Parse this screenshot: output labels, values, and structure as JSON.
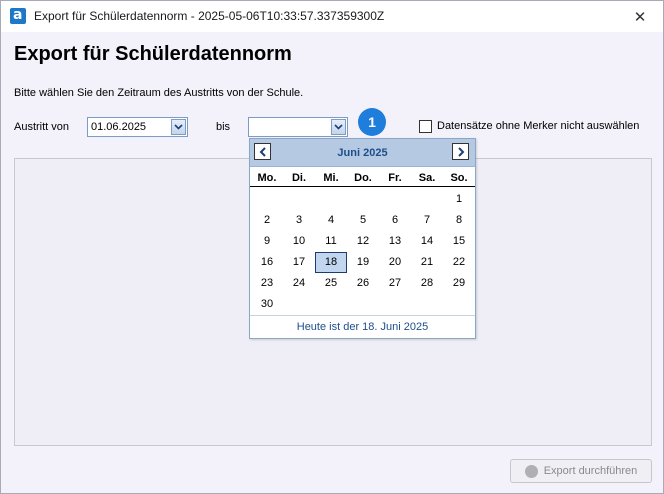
{
  "window": {
    "title": "Export für Schülerdatennorm - 2025-05-06T10:33:57.337359300Z",
    "close_glyph": "✕"
  },
  "header": {
    "title": "Export für Schülerdatennorm",
    "instruction": "Bitte wählen Sie den Zeitraum des Austritts von der Schule."
  },
  "filter": {
    "from_label": "Austritt von",
    "from_value": "01.06.2025",
    "to_label": "bis",
    "to_value": "",
    "marker": "1",
    "checkbox_label": "Datensätze ohne Merker nicht auswählen",
    "checkbox_checked": false
  },
  "calendar": {
    "month_label": "Juni 2025",
    "prev_glyph": "<",
    "next_glyph": ">",
    "weekdays": [
      "Mo.",
      "Di.",
      "Mi.",
      "Do.",
      "Fr.",
      "Sa.",
      "So."
    ],
    "weeks": [
      [
        "",
        "",
        "",
        "",
        "",
        "",
        "1"
      ],
      [
        "2",
        "3",
        "4",
        "5",
        "6",
        "7",
        "8"
      ],
      [
        "9",
        "10",
        "11",
        "12",
        "13",
        "14",
        "15"
      ],
      [
        "16",
        "17",
        "18",
        "19",
        "20",
        "21",
        "22"
      ],
      [
        "23",
        "24",
        "25",
        "26",
        "27",
        "28",
        "29"
      ],
      [
        "30",
        "",
        "",
        "",
        "",
        "",
        ""
      ]
    ],
    "selected_day": "18",
    "today_text": "Heute ist der 18. Juni 2025"
  },
  "footer": {
    "export_label": "Export durchführen",
    "export_enabled": false
  },
  "colors": {
    "accent": "#1f7ddb",
    "calendar_header": "#b6c9e3",
    "calendar_text": "#1d4e8a",
    "selected_day_bg": "#c2d6ef"
  }
}
